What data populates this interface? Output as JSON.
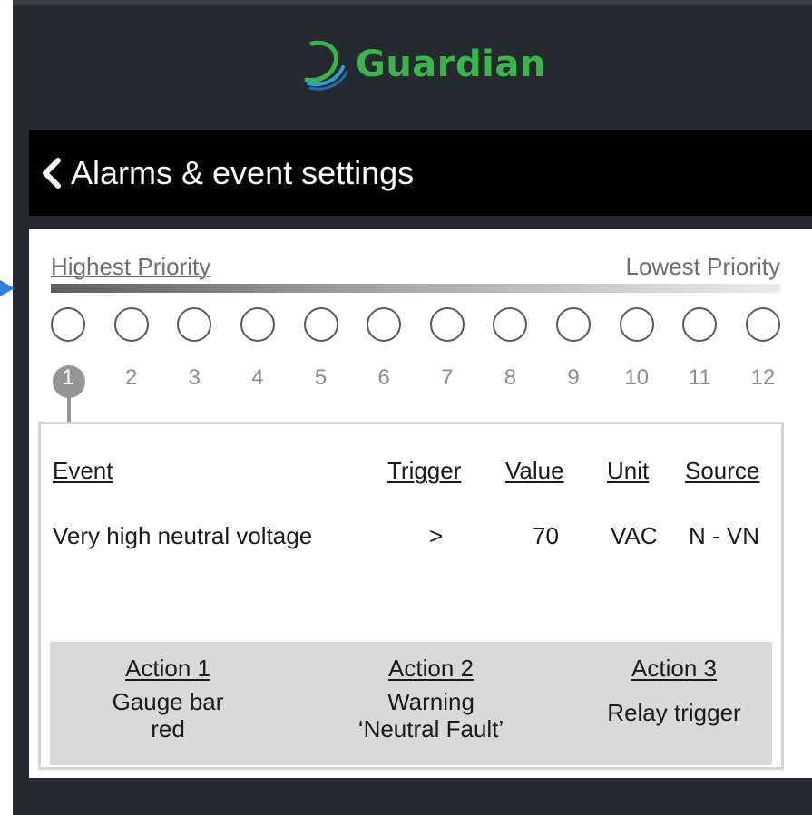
{
  "app": {
    "logo_text": "Guardian",
    "brand_color": "#3ab54a"
  },
  "header": {
    "title": "Alarms & event settings",
    "back_icon": "chevron-left-icon"
  },
  "priority": {
    "highest_label": "Highest Priority",
    "lowest_label": "Lowest Priority",
    "levels": [
      "1",
      "2",
      "3",
      "4",
      "5",
      "6",
      "7",
      "8",
      "9",
      "10",
      "11",
      "12"
    ],
    "selected": "1"
  },
  "table": {
    "headers": {
      "event": "Event",
      "trigger": "Trigger",
      "value": "Value",
      "unit": "Unit",
      "source": "Source"
    },
    "row": {
      "event": "Very high neutral voltage",
      "trigger": ">",
      "value": "70",
      "unit": "VAC",
      "source": "N - VN"
    }
  },
  "actions": [
    {
      "title": "Action 1",
      "line1": "Gauge bar",
      "line2": "red"
    },
    {
      "title": "Action 2",
      "line1": "Warning",
      "line2": "‘Neutral Fault’"
    },
    {
      "title": "Action 3",
      "line1": "Relay trigger",
      "line2": ""
    }
  ]
}
